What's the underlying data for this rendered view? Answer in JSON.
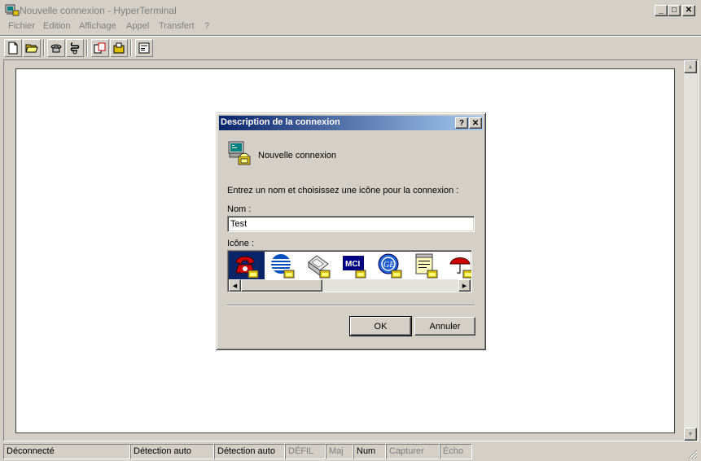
{
  "window": {
    "title": "Nouvelle connexion - HyperTerminal",
    "controls": {
      "minimize": "_",
      "maximize": "□",
      "close": "✕"
    }
  },
  "menu": {
    "items": [
      "Fichier",
      "Edition",
      "Affichage",
      "Appel",
      "Transfert",
      "?"
    ]
  },
  "toolbar": {
    "buttons": [
      "new-icon",
      "open-icon",
      "call-icon",
      "disconnect-icon",
      "send-icon",
      "receive-icon",
      "properties-icon"
    ]
  },
  "statusbar": {
    "cells": [
      {
        "text": "Déconnecté",
        "dim": false
      },
      {
        "text": "Détection auto",
        "dim": false
      },
      {
        "text": "Détection auto",
        "dim": false
      },
      {
        "text": "DÉFIL",
        "dim": true
      },
      {
        "text": "Maj",
        "dim": true
      },
      {
        "text": "Num",
        "dim": false
      },
      {
        "text": "Capturer",
        "dim": true
      },
      {
        "text": "Écho",
        "dim": true
      }
    ]
  },
  "dialog": {
    "title": "Description de la connexion",
    "help_btn": "?",
    "close_btn": "✕",
    "connection_name": "Nouvelle connexion",
    "instruction": "Entrez un nom et choisissez une icône pour la connexion :",
    "name_label": "Nom :",
    "name_value": "Test",
    "icon_label": "Icône :",
    "icons": [
      "phone-red-icon",
      "globe-stripes-icon",
      "fax-icon",
      "mci-icon",
      "ge-globe-icon",
      "notepad-icon",
      "umbrella-icon"
    ],
    "selected_icon": 0,
    "ok_label": "OK",
    "cancel_label": "Annuler"
  },
  "colors": {
    "face": "#d4d0c8",
    "dialog_title_start": "#0a246a",
    "dialog_title_end": "#a6caf0",
    "selection": "#0a246a"
  }
}
